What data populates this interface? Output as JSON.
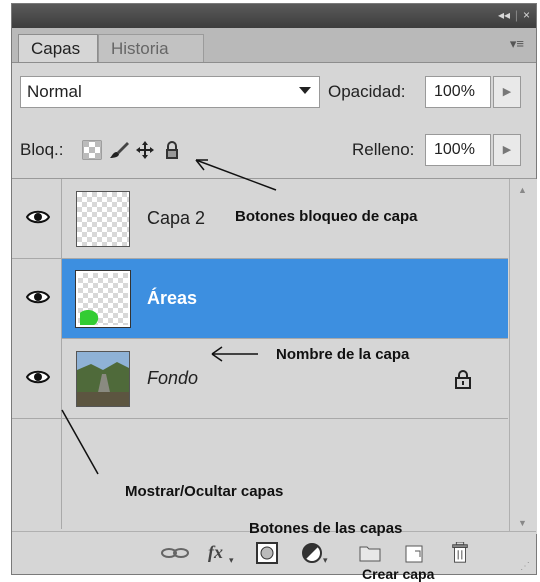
{
  "window": {
    "collapse_icon": "double-chevron-left-icon",
    "close_icon": "close-icon",
    "collapse_glyph": "◂◂",
    "close_glyph": "×"
  },
  "tabs": [
    {
      "label": "Capas"
    },
    {
      "label": "Historia"
    }
  ],
  "panel_menu_glyph": "▾≡",
  "blend": {
    "value": "Normal"
  },
  "opacity": {
    "label": "Opacidad:",
    "value": "100%"
  },
  "lock": {
    "label": "Bloq.:"
  },
  "fill": {
    "label": "Relleno:",
    "value": "100%"
  },
  "layers": [
    {
      "name": "Capa 2",
      "visible": true,
      "selected": false
    },
    {
      "name": "Áreas",
      "visible": true,
      "selected": true
    },
    {
      "name": "Fondo",
      "visible": true,
      "selected": false,
      "locked": true
    }
  ],
  "annotations": {
    "lock_buttons": "Botones bloqueo de capa",
    "layer_name": "Nombre de la capa",
    "show_hide": "Mostrar/Ocultar capas",
    "layer_buttons": "Botones de las capas",
    "create_layer": "Crear capa"
  },
  "colors": {
    "selection": "#3d8fe0",
    "panel_bg": "#d6d6d6",
    "titlebar": "#3d3d3d"
  }
}
